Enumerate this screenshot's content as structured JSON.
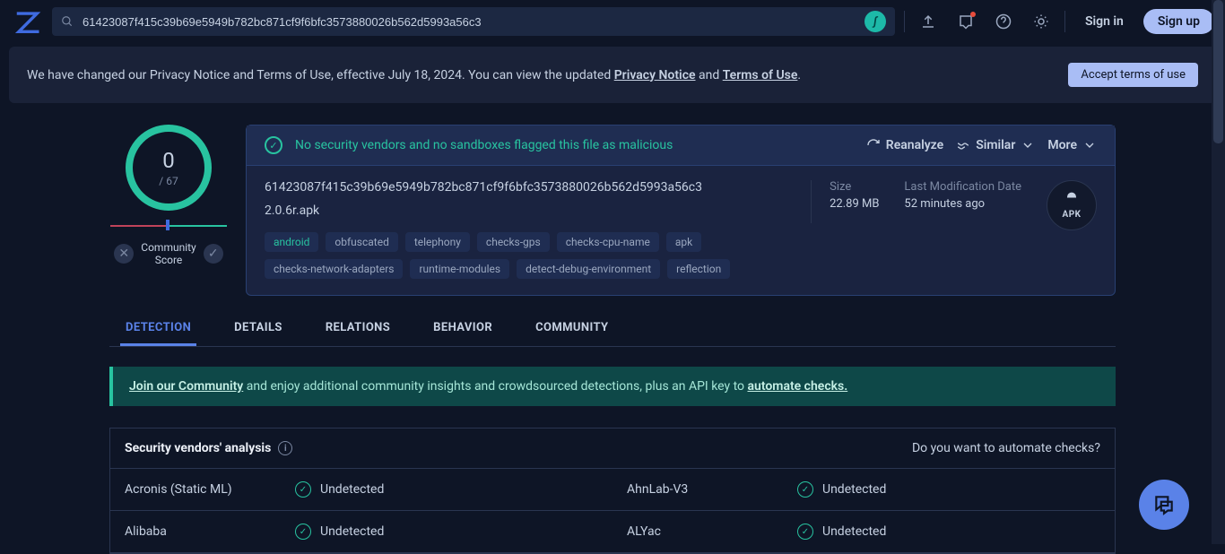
{
  "header": {
    "search_value": "61423087f415c39b69e5949b782bc871cf9f6bfc3573880026b562d5993a56c3",
    "signin": "Sign in",
    "signup": "Sign up"
  },
  "notice": {
    "part1": "We have changed our Privacy Notice and Terms of Use, effective July 18, 2024. You can view the updated ",
    "privacy": "Privacy Notice",
    "and": " and ",
    "terms": "Terms of Use",
    "dot": ".",
    "accept": "Accept terms of use"
  },
  "score": {
    "detections": "0",
    "total": "/ 67",
    "community_label_1": "Community",
    "community_label_2": "Score"
  },
  "flag": "No security vendors and no sandboxes flagged this file as malicious",
  "actions": {
    "reanalyze": "Reanalyze",
    "similar": "Similar",
    "more": "More"
  },
  "hash": "61423087f415c39b69e5949b782bc871cf9f6bfc3573880026b562d5993a56c3",
  "filename": "2.0.6r.apk",
  "tags": [
    "android",
    "obfuscated",
    "telephony",
    "checks-gps",
    "checks-cpu-name",
    "apk",
    "checks-network-adapters",
    "runtime-modules",
    "detect-debug-environment",
    "reflection"
  ],
  "meta": {
    "size_label": "Size",
    "size": "22.89 MB",
    "mod_label": "Last Modification Date",
    "mod": "52 minutes ago"
  },
  "apk_label": "APK",
  "tabs": [
    "DETECTION",
    "DETAILS",
    "RELATIONS",
    "BEHAVIOR",
    "COMMUNITY"
  ],
  "join": {
    "p1": "Join our Community",
    "p2": " and enjoy additional community insights and crowdsourced detections, plus an API key to ",
    "p3": "automate checks."
  },
  "analysis": {
    "title": "Security vendors' analysis",
    "automate": "Do you want to automate checks?",
    "rows": [
      {
        "left_vendor": "Acronis (Static ML)",
        "left_status": "Undetected",
        "right_vendor": "AhnLab-V3",
        "right_status": "Undetected"
      },
      {
        "left_vendor": "Alibaba",
        "left_status": "Undetected",
        "right_vendor": "ALYac",
        "right_status": "Undetected"
      }
    ]
  }
}
